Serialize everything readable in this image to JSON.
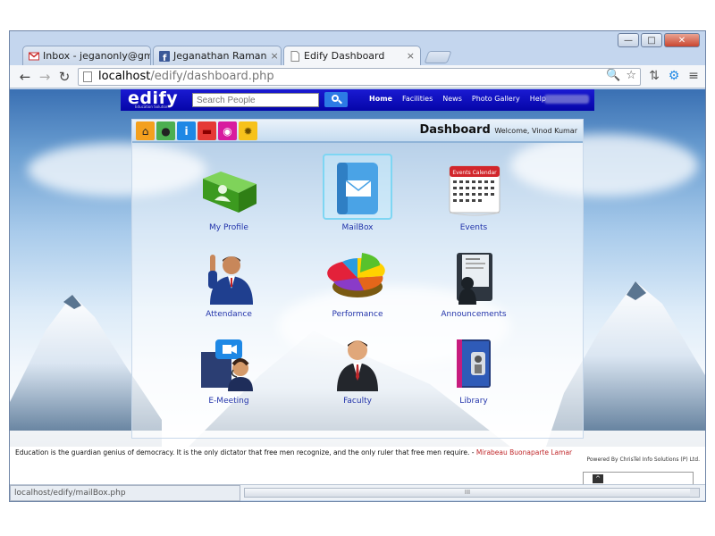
{
  "browser": {
    "tabs": [
      {
        "label": "Inbox - jeganonly@gmail.",
        "icon": "gmail-icon"
      },
      {
        "label": "Jeganathan Raman",
        "icon": "facebook-icon"
      },
      {
        "label": "Edify Dashboard",
        "icon": "page-icon"
      }
    ],
    "close_glyph": "×",
    "url_host": "localhost",
    "url_path": "/edify/dashboard.php",
    "status_url": "localhost/edify/mailBox.php",
    "window_buttons": {
      "minimize": "—",
      "maximize": "□",
      "close": "✕"
    },
    "nav": {
      "back": "←",
      "forward": "→",
      "reload": "↻"
    },
    "omni_icons": {
      "zoom": "🔍",
      "star": "☆"
    },
    "right_icons": {
      "translate": "⇅",
      "extension": "⚙",
      "menu": "≡"
    },
    "scroll_grip": "III"
  },
  "site": {
    "logo": "edify",
    "logo_tagline": "Education Solutions",
    "search_placeholder": "Search People",
    "menu": [
      "Home",
      "Facilities",
      "News",
      "Photo Gallery",
      "Help"
    ],
    "active_menu": "Home"
  },
  "dashboard": {
    "title": "Dashboard",
    "welcome": "Welcome, Vinod Kumar",
    "quick_icons": [
      {
        "name": "home-icon",
        "glyph": "⌂",
        "color": "#f3a01e"
      },
      {
        "name": "user-icon",
        "glyph": "●",
        "color": "#4caf50"
      },
      {
        "name": "info-icon",
        "glyph": "i",
        "color": "#1e88e5"
      },
      {
        "name": "folder-icon",
        "glyph": "▬",
        "color": "#e53935"
      },
      {
        "name": "mouse-icon",
        "glyph": "◉",
        "color": "#d81b9f"
      },
      {
        "name": "settings-icon",
        "glyph": "✹",
        "color": "#f6c21b"
      }
    ],
    "tiles": [
      {
        "label": "My Profile",
        "icon": "folder-profile-icon"
      },
      {
        "label": "MailBox",
        "icon": "mailbox-icon"
      },
      {
        "label": "Events",
        "icon": "calendar-icon"
      },
      {
        "label": "Attendance",
        "icon": "attendance-person-icon"
      },
      {
        "label": "Performance",
        "icon": "pie-chart-icon"
      },
      {
        "label": "Announcements",
        "icon": "announcements-icon"
      },
      {
        "label": "E-Meeting",
        "icon": "video-meeting-icon"
      },
      {
        "label": "Faculty",
        "icon": "faculty-person-icon"
      },
      {
        "label": "Library",
        "icon": "library-book-icon"
      }
    ],
    "calendar_header": "Events Calendar"
  },
  "footer": {
    "quote": "Education is the guardian genius of democracy. It is the only dictator that free men recognize, and the only ruler that free men require. -",
    "author": "Mirabeau Buonaparte Lamar",
    "powered": "Powered By ChrisTel Info Solutions (P) Ltd.",
    "back_to_top": "^"
  },
  "colors": {
    "header_blue": "#0d0dc0",
    "tile_label": "#2233aa",
    "author_red": "#c0282b",
    "selected_outline": "#7ed6f3"
  }
}
